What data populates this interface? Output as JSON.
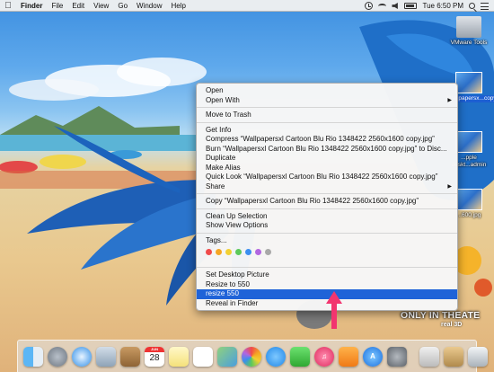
{
  "menubar": {
    "apple_icon": "apple-logo-icon",
    "app_name": "Finder",
    "menus": [
      "File",
      "Edit",
      "View",
      "Go",
      "Window",
      "Help"
    ],
    "clock": "Tue 6:50 PM"
  },
  "desktop_icons": [
    {
      "label": "VMware Tools",
      "selected": false
    },
    {
      "label": "Wallpapersx...copy.jpg",
      "selected": true
    },
    {
      "label": "...pple deskt...admin",
      "selected": false
    },
    {
      "label": "...600.jpg",
      "selected": false
    }
  ],
  "context_menu": {
    "sections": [
      [
        {
          "label": "Open"
        },
        {
          "label": "Open With",
          "submenu": true
        }
      ],
      [
        {
          "label": "Move to Trash"
        }
      ],
      [
        {
          "label": "Get Info"
        },
        {
          "label": "Compress “Wallpapersxl Cartoon Blu Rio 1348422 2560x1600 copy.jpg”"
        },
        {
          "label": "Burn “Wallpapersxl Cartoon Blu Rio 1348422 2560x1600 copy.jpg” to Disc..."
        },
        {
          "label": "Duplicate"
        },
        {
          "label": "Make Alias"
        },
        {
          "label": "Quick Look “Wallpapersxl Cartoon Blu Rio 1348422 2560x1600 copy.jpg”"
        },
        {
          "label": "Share",
          "submenu": true
        }
      ],
      [
        {
          "label": "Copy “Wallpapersxl Cartoon Blu Rio 1348422 2560x1600 copy.jpg”"
        }
      ],
      [
        {
          "label": "Clean Up Selection"
        },
        {
          "label": "Show View Options"
        }
      ],
      [
        {
          "label": "Tags..."
        }
      ]
    ],
    "tag_colors": [
      "#f04a4a",
      "#f5a623",
      "#f2d033",
      "#5cc95a",
      "#3a8ef0",
      "#b266e0",
      "#a8a8a8"
    ],
    "services": [
      {
        "label": "Set Desktop Picture",
        "highlighted": false
      },
      {
        "label": "Resize to 550",
        "highlighted": false
      },
      {
        "label": "resize 550",
        "highlighted": true
      },
      {
        "label": "Reveal in Finder",
        "highlighted": false
      }
    ]
  },
  "overlay_text": {
    "only_in_theaters": "ONLY IN THEATE",
    "real3d": "real 3D"
  },
  "dock": {
    "calendar": {
      "month": "JUN",
      "day": "28"
    },
    "apps": [
      "finder-icon",
      "launchpad-icon",
      "safari-icon",
      "mail-icon",
      "contacts-icon",
      "calendar-icon",
      "notes-icon",
      "reminders-icon",
      "maps-icon",
      "photos-icon",
      "messages-icon",
      "facetime-icon",
      "itunes-icon",
      "ibooks-icon",
      "app-store-icon",
      "system-preferences-icon",
      "preview-icon",
      "downloads-stack-icon",
      "trash-icon"
    ]
  }
}
